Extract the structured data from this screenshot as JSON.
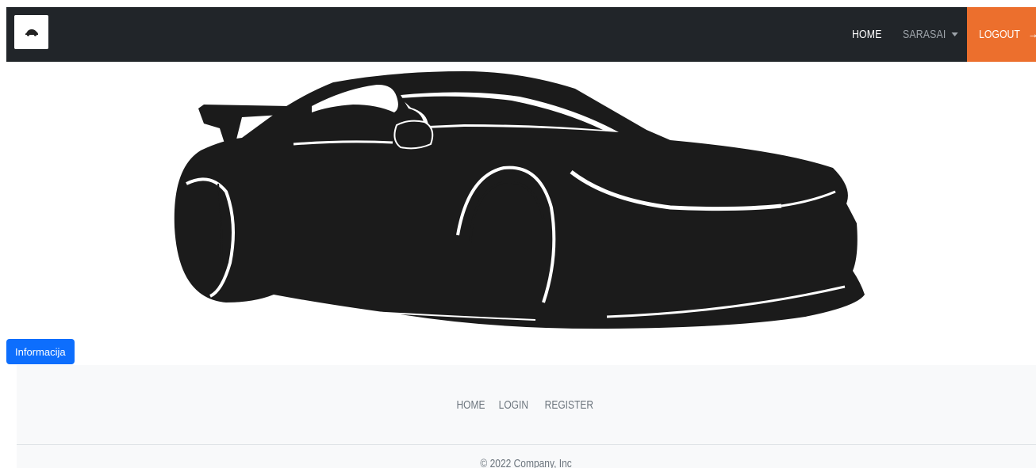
{
  "navbar": {
    "brand_icon": "car-icon",
    "links": {
      "home": "HOME",
      "user": "SARASAI",
      "logout": "LOGOUT"
    },
    "logout_arrow": "→",
    "colors": {
      "background": "#212529",
      "logout_bg": "#ec6f2d"
    }
  },
  "hero": {
    "image": "car-silhouette"
  },
  "info_button": {
    "label": "Informacija",
    "color": "#0d6efd"
  },
  "footer": {
    "links": [
      "HOME",
      "LOGIN",
      "REGISTER"
    ],
    "copyright": "© 2022 Company, Inc"
  }
}
